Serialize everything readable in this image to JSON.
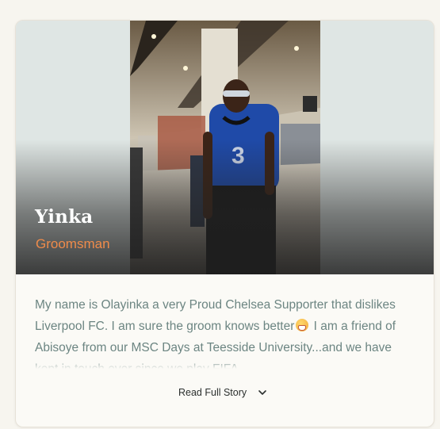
{
  "profile": {
    "name": "Yinka",
    "role": "Groomsman",
    "story_parts": [
      "My name is Olayinka a very Proud Chelsea Supporter that dislikes Liverpool FC. I am sure the groom knows better",
      " I am a friend of Abisoye from our MSC Days at Teesside University...and we have kept in touch ever since we play FIFA"
    ],
    "emoji": "grinning-face-emoji",
    "read_more_label": "Read Full Story",
    "read_more_icon": "chevron-down-icon"
  },
  "colors": {
    "page_bg": "#f7f5ef",
    "card_bg": "#fbfaf6",
    "role": "#ef8b4a",
    "story_text": "#6c8582",
    "hero_side_bg": "#dfe6e4"
  }
}
